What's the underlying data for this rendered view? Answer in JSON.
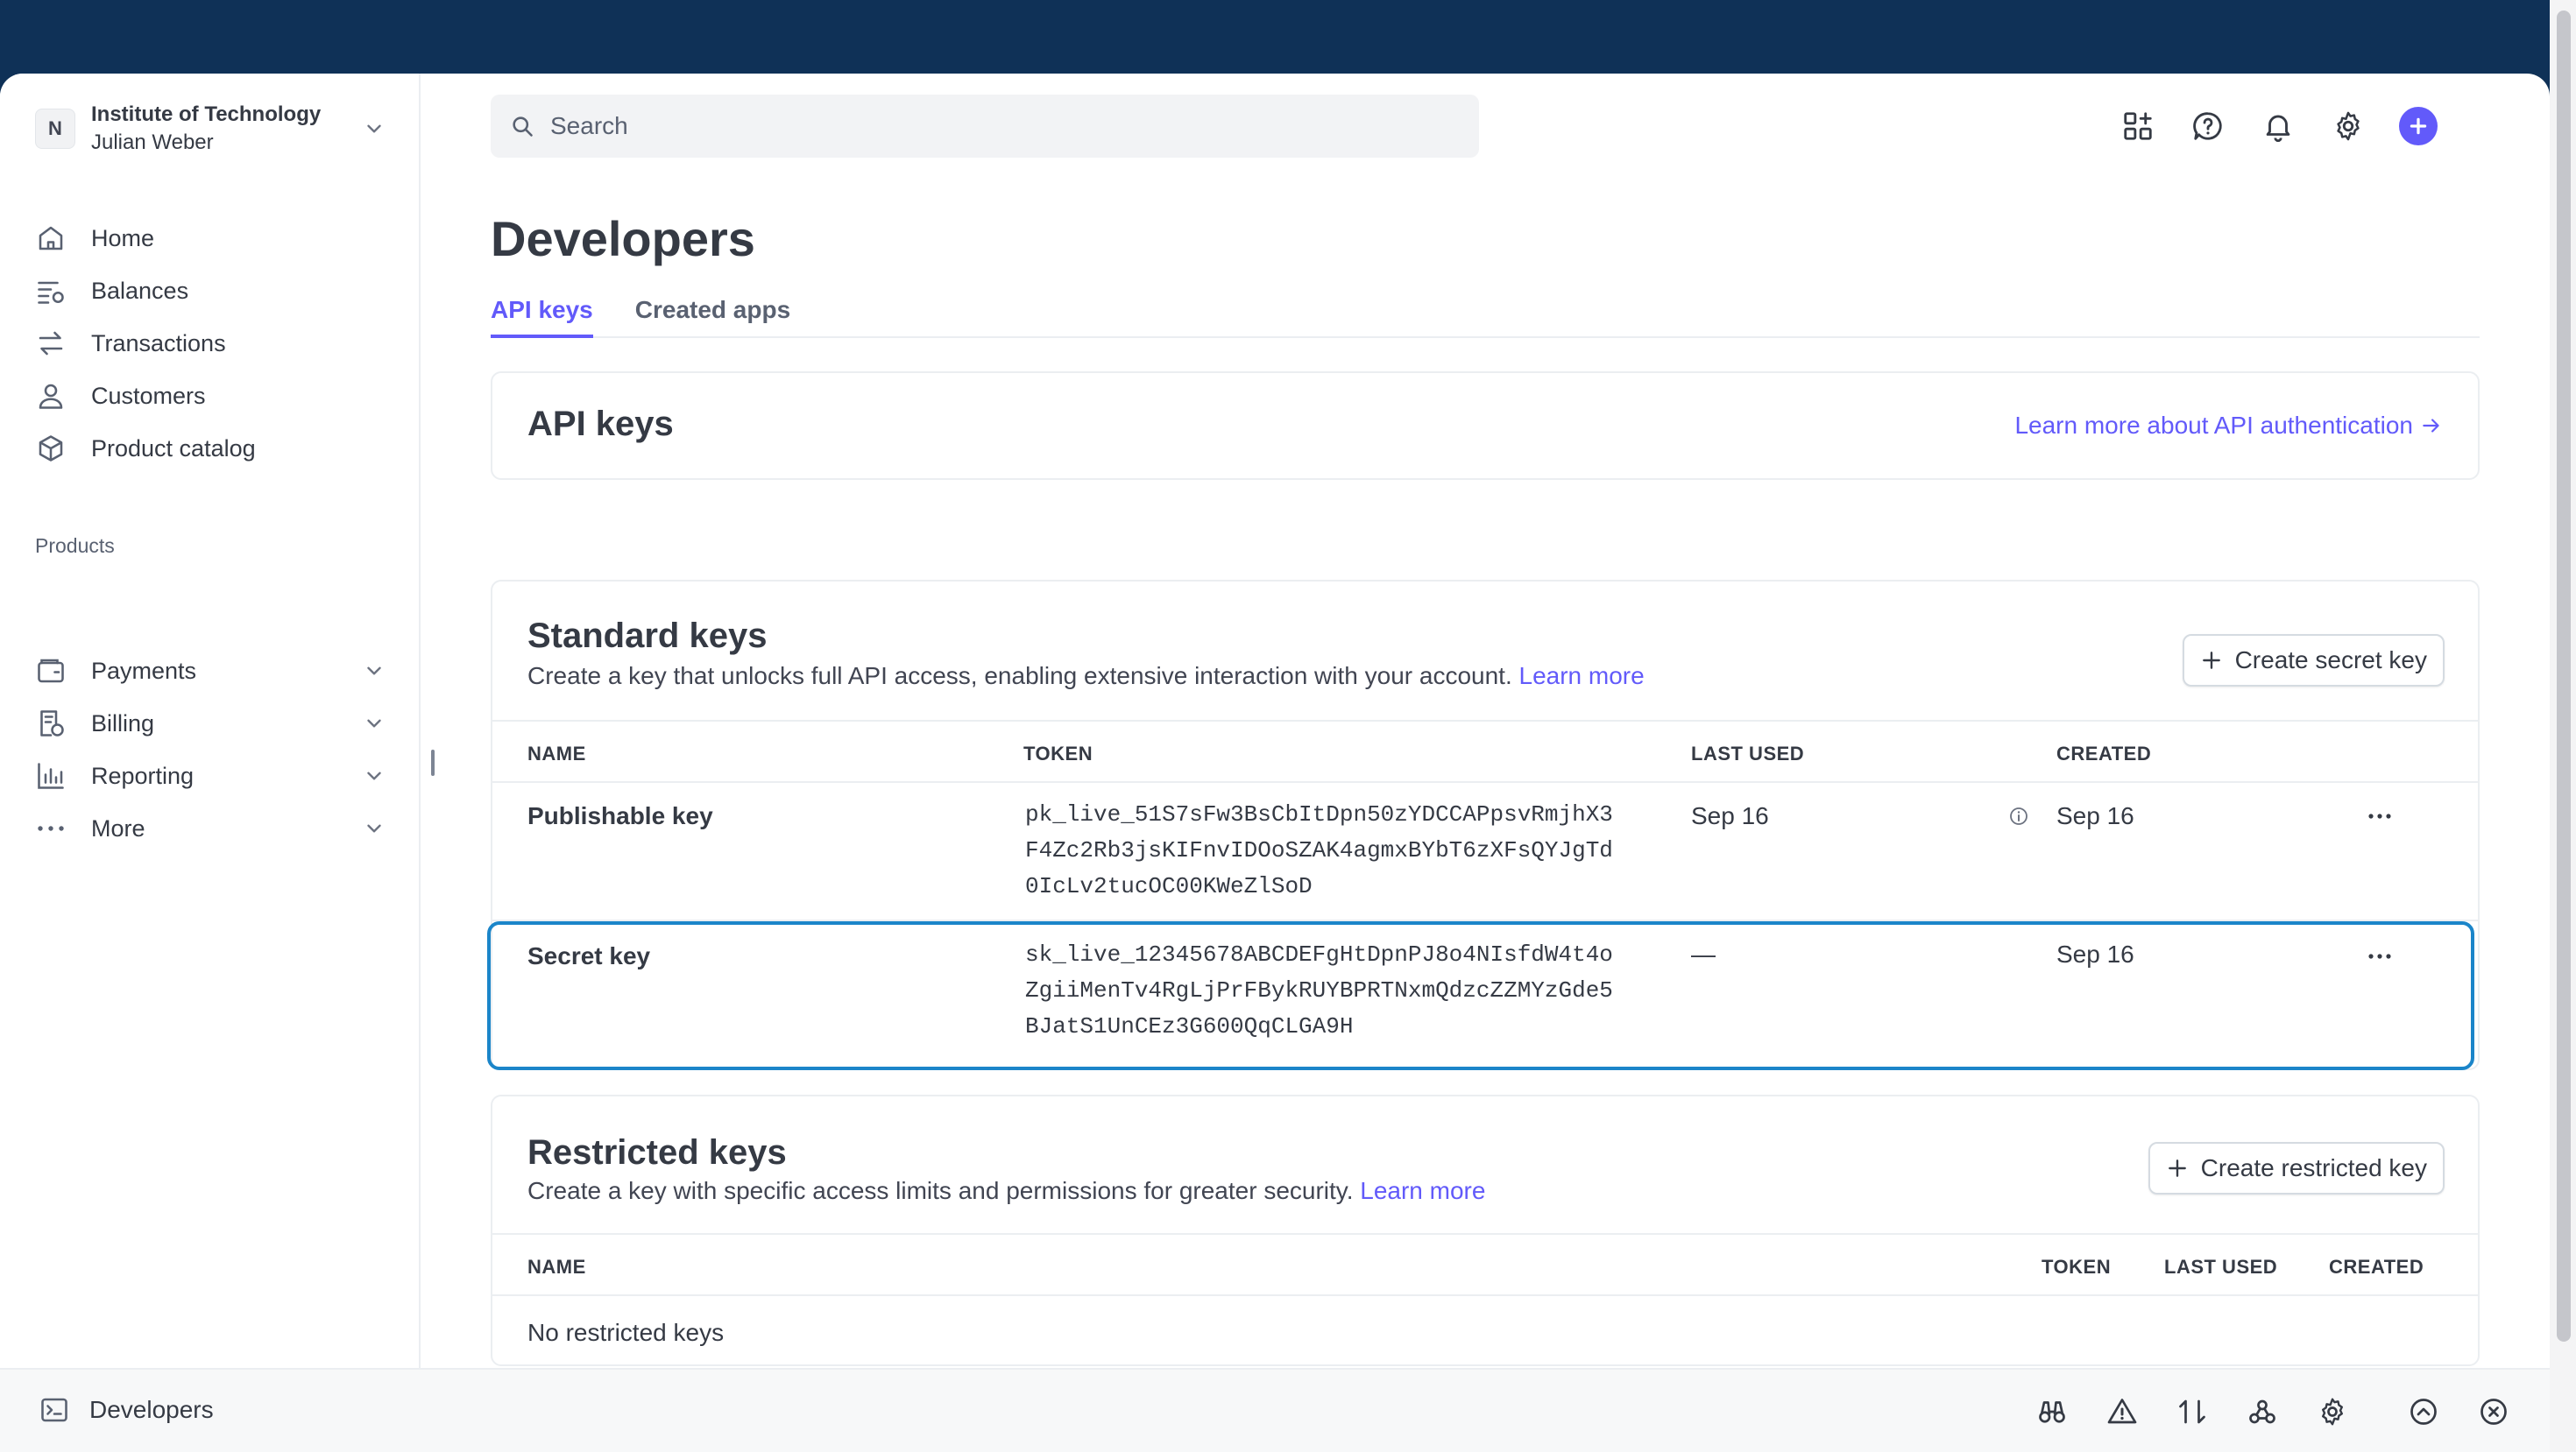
{
  "account": {
    "avatar_letter": "N",
    "org": "Institute of Technology",
    "user": "Julian Weber"
  },
  "nav": {
    "main": [
      {
        "label": "Home",
        "icon": "home-icon"
      },
      {
        "label": "Balances",
        "icon": "balances-icon"
      },
      {
        "label": "Transactions",
        "icon": "transactions-icon"
      },
      {
        "label": "Customers",
        "icon": "customers-icon"
      },
      {
        "label": "Product catalog",
        "icon": "product-catalog-icon"
      }
    ],
    "products_label": "Products",
    "products": [
      {
        "label": "Payments",
        "icon": "payments-icon"
      },
      {
        "label": "Billing",
        "icon": "billing-icon"
      },
      {
        "label": "Reporting",
        "icon": "reporting-icon"
      },
      {
        "label": "More",
        "icon": "more-dots-icon"
      }
    ]
  },
  "search": {
    "placeholder": "Search"
  },
  "page": {
    "title": "Developers",
    "tabs": [
      {
        "label": "API keys",
        "active": true
      },
      {
        "label": "Created apps",
        "active": false
      }
    ]
  },
  "api_card": {
    "title": "API keys",
    "link": "Learn more about API authentication"
  },
  "standard": {
    "title": "Standard keys",
    "desc": "Create a key that unlocks full API access, enabling extensive interaction with your account.",
    "learn_more": "Learn more",
    "button": "Create secret key",
    "headers": [
      "NAME",
      "TOKEN",
      "LAST USED",
      "CREATED"
    ],
    "rows": [
      {
        "name": "Publishable key",
        "token": "pk_live_51S7sFw3BsCbItDpn50zYDCCAPpsvRmjhX3F4Zc2Rb3jsKIFnvIDOoSZAK4agmxBYbT6zXFsQYJgTd0IcLv2tucOC00KWeZlSoD",
        "last_used": "Sep 16",
        "created": "Sep 16"
      },
      {
        "name": "Secret key",
        "token": "sk_live_12345678ABCDEFgHtDpnPJ8o4NIsfdW4t4oZgiiMenTv4RgLjPrFBykRUYBPRTNxmQdzcZZMYzGde5BJatS1UnCEz3G600QqCLGA9H",
        "last_used": "—",
        "created": "Sep 16"
      }
    ]
  },
  "restricted": {
    "title": "Restricted keys",
    "desc": "Create a key with specific access limits and permissions for greater security.",
    "learn_more": "Learn more",
    "button": "Create restricted key",
    "headers": {
      "name": "NAME",
      "token": "TOKEN",
      "last_used": "LAST USED",
      "created": "CREATED"
    },
    "empty": "No restricted keys"
  },
  "bottombar": {
    "label": "Developers"
  },
  "colors": {
    "accent": "#625afa",
    "topbar": "#0f3157",
    "selection": "#1b85c9"
  }
}
